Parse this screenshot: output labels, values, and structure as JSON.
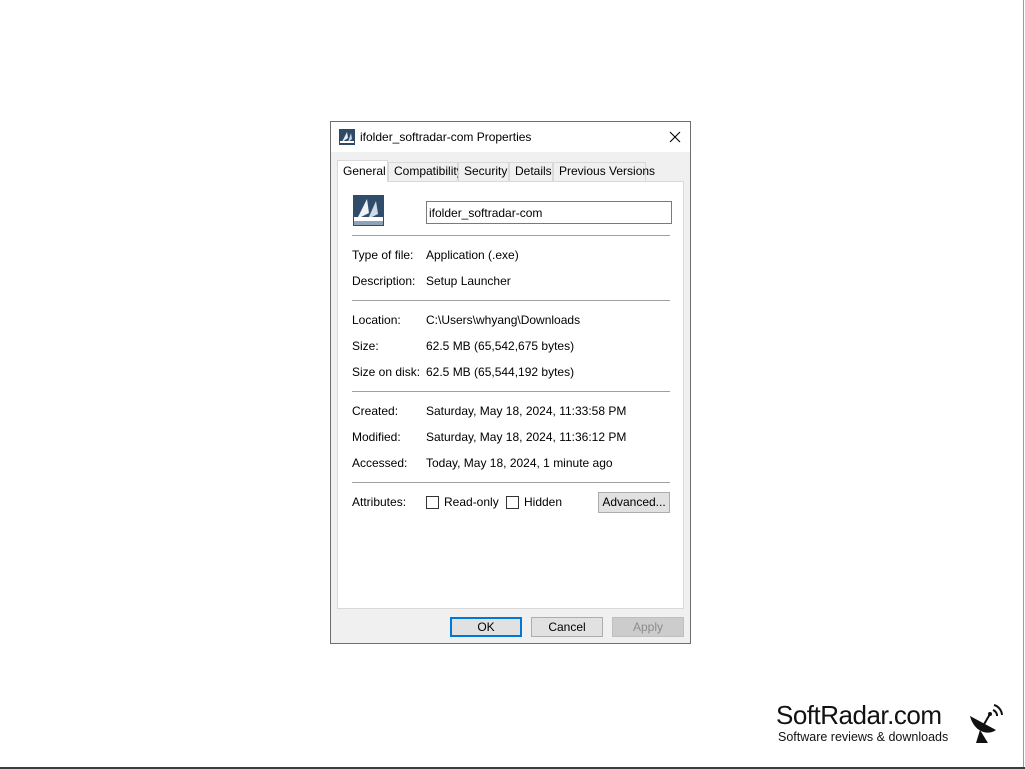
{
  "window": {
    "title": "ifolder_softradar-com Properties",
    "icon": "setup-launcher-icon",
    "close_icon": "close-icon"
  },
  "tabs": [
    {
      "label": "General",
      "active": true
    },
    {
      "label": "Compatibility",
      "active": false
    },
    {
      "label": "Security",
      "active": false
    },
    {
      "label": "Details",
      "active": false
    },
    {
      "label": "Previous Versions",
      "active": false
    }
  ],
  "general": {
    "file_name": "ifolder_softradar-com",
    "type_label": "Type of file:",
    "type_value": "Application (.exe)",
    "description_label": "Description:",
    "description_value": "Setup Launcher",
    "location_label": "Location:",
    "location_value": "C:\\Users\\whyang\\Downloads",
    "size_label": "Size:",
    "size_value": "62.5 MB (65,542,675 bytes)",
    "size_on_disk_label": "Size on disk:",
    "size_on_disk_value": "62.5 MB (65,544,192 bytes)",
    "created_label": "Created:",
    "created_value": "Saturday, May 18, 2024, 11:33:58 PM",
    "modified_label": "Modified:",
    "modified_value": "Saturday, May 18, 2024, 11:36:12 PM",
    "accessed_label": "Accessed:",
    "accessed_value": "Today, May 18, 2024, 1 minute ago",
    "attributes_label": "Attributes:",
    "readonly_label": "Read-only",
    "readonly_checked": false,
    "hidden_label": "Hidden",
    "hidden_checked": false,
    "advanced_label": "Advanced..."
  },
  "buttons": {
    "ok": "OK",
    "cancel": "Cancel",
    "apply": "Apply"
  },
  "colors": {
    "focus_accent": "#0078d7",
    "dialog_bg": "#f0f0f0"
  },
  "watermark": {
    "name": "SoftRadar.com",
    "tagline": "Software reviews & downloads",
    "icon": "satellite-dish-icon"
  }
}
